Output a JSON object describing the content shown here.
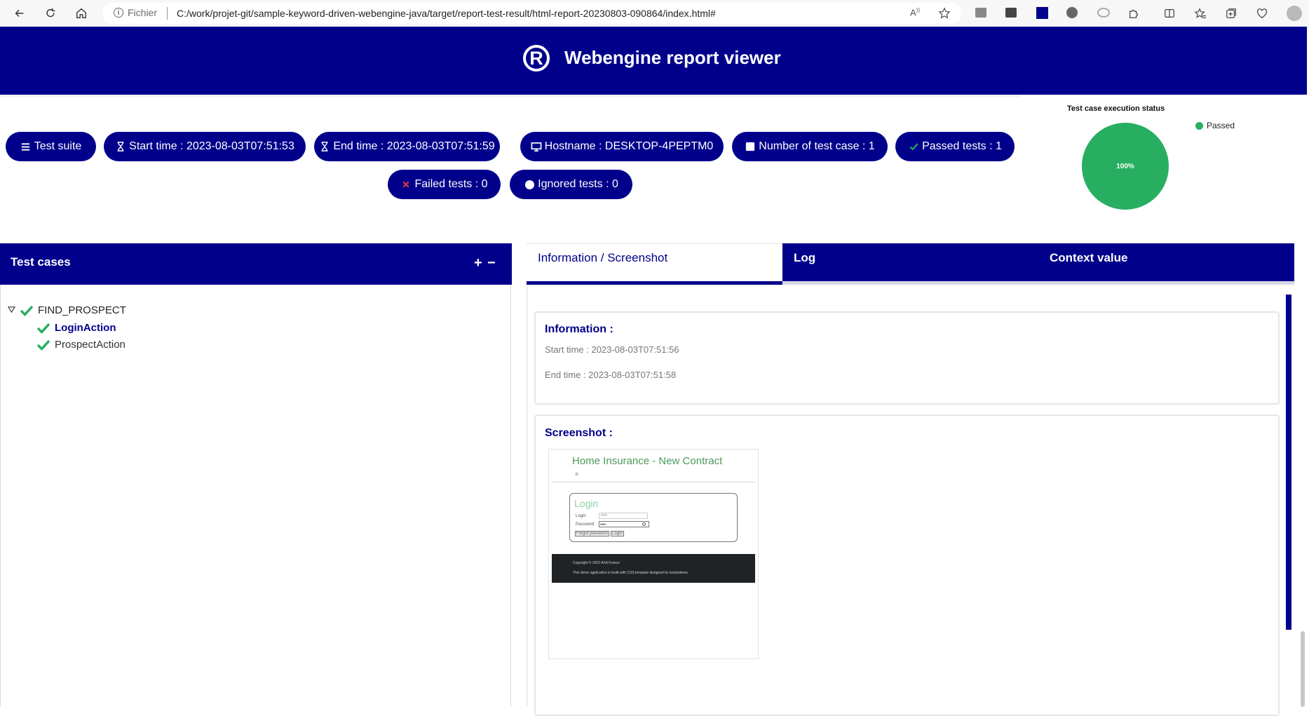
{
  "browser": {
    "security_label": "Fichier",
    "url": "C:/work/projet-git/sample-keyword-driven-webengine-java/target/report-test-result/html-report-20230803-090864/index.html#"
  },
  "header": {
    "logo_symbol": "R",
    "title": "Webengine report viewer"
  },
  "summary": {
    "test_suite": "Test suite",
    "start_time": "Start time : 2023-08-03T07:51:53",
    "end_time": "End time : 2023-08-03T07:51:59",
    "hostname": "Hostname : DESKTOP-4PEPTM0",
    "num_test_cases": "Number of test case : 1",
    "passed": "Passed tests : 1",
    "failed": "Failed tests : 0",
    "ignored": "Ignored tests : 0"
  },
  "chart_data": {
    "type": "pie",
    "title": "Test case execution status",
    "categories": [
      "Passed"
    ],
    "values": [
      100
    ],
    "labels": [
      "100%"
    ],
    "colors": [
      "#27ae60"
    ],
    "legend": "top-right"
  },
  "test_cases": {
    "title": "Test cases",
    "expand_symbol": "+",
    "collapse_symbol": "−",
    "tree": {
      "name": "FIND_PROSPECT",
      "children": [
        {
          "name": "LoginAction",
          "selected": true
        },
        {
          "name": "ProspectAction",
          "selected": false
        }
      ]
    }
  },
  "tabs": {
    "info": "Information / Screenshot",
    "log": "Log",
    "context": "Context value"
  },
  "information": {
    "title": "Information :",
    "start_time": "Start time : 2023-08-03T07:51:56",
    "end_time": "End time : 2023-08-03T07:51:58"
  },
  "screenshot": {
    "title": "Screenshot :",
    "page_title": "Home Insurance - New Contract",
    "menu_icon": "≡",
    "login_title": "Login",
    "login_label": "Login",
    "login_value": "xxx",
    "password_label": "Password",
    "forgot_button": "Forgot password",
    "login_button": "Login",
    "footer_copyright": "Copyright © 2022 AXA France",
    "footer_note": "This demo application is build with CSS template designed by templatemo"
  },
  "colors": {
    "primary": "#00008b",
    "success": "#27ae60",
    "failed": "#e53935"
  }
}
